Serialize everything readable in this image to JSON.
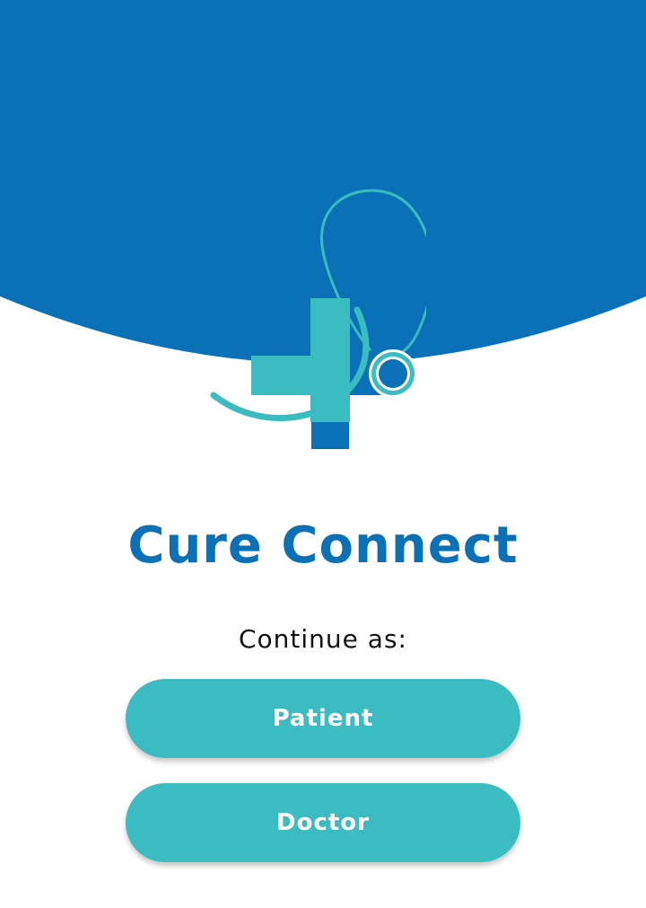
{
  "app": {
    "title": "Cure Connect"
  },
  "prompt": {
    "label": "Continue as:"
  },
  "roles": {
    "patient_label": "Patient",
    "doctor_label": "Doctor"
  },
  "colors": {
    "primary_blue": "#0b71b7",
    "teal": "#3bbcc0",
    "text_dark": "#111111",
    "background": "#ffffff"
  },
  "icons": {
    "logo": "medical-cross-stethoscope-icon"
  }
}
